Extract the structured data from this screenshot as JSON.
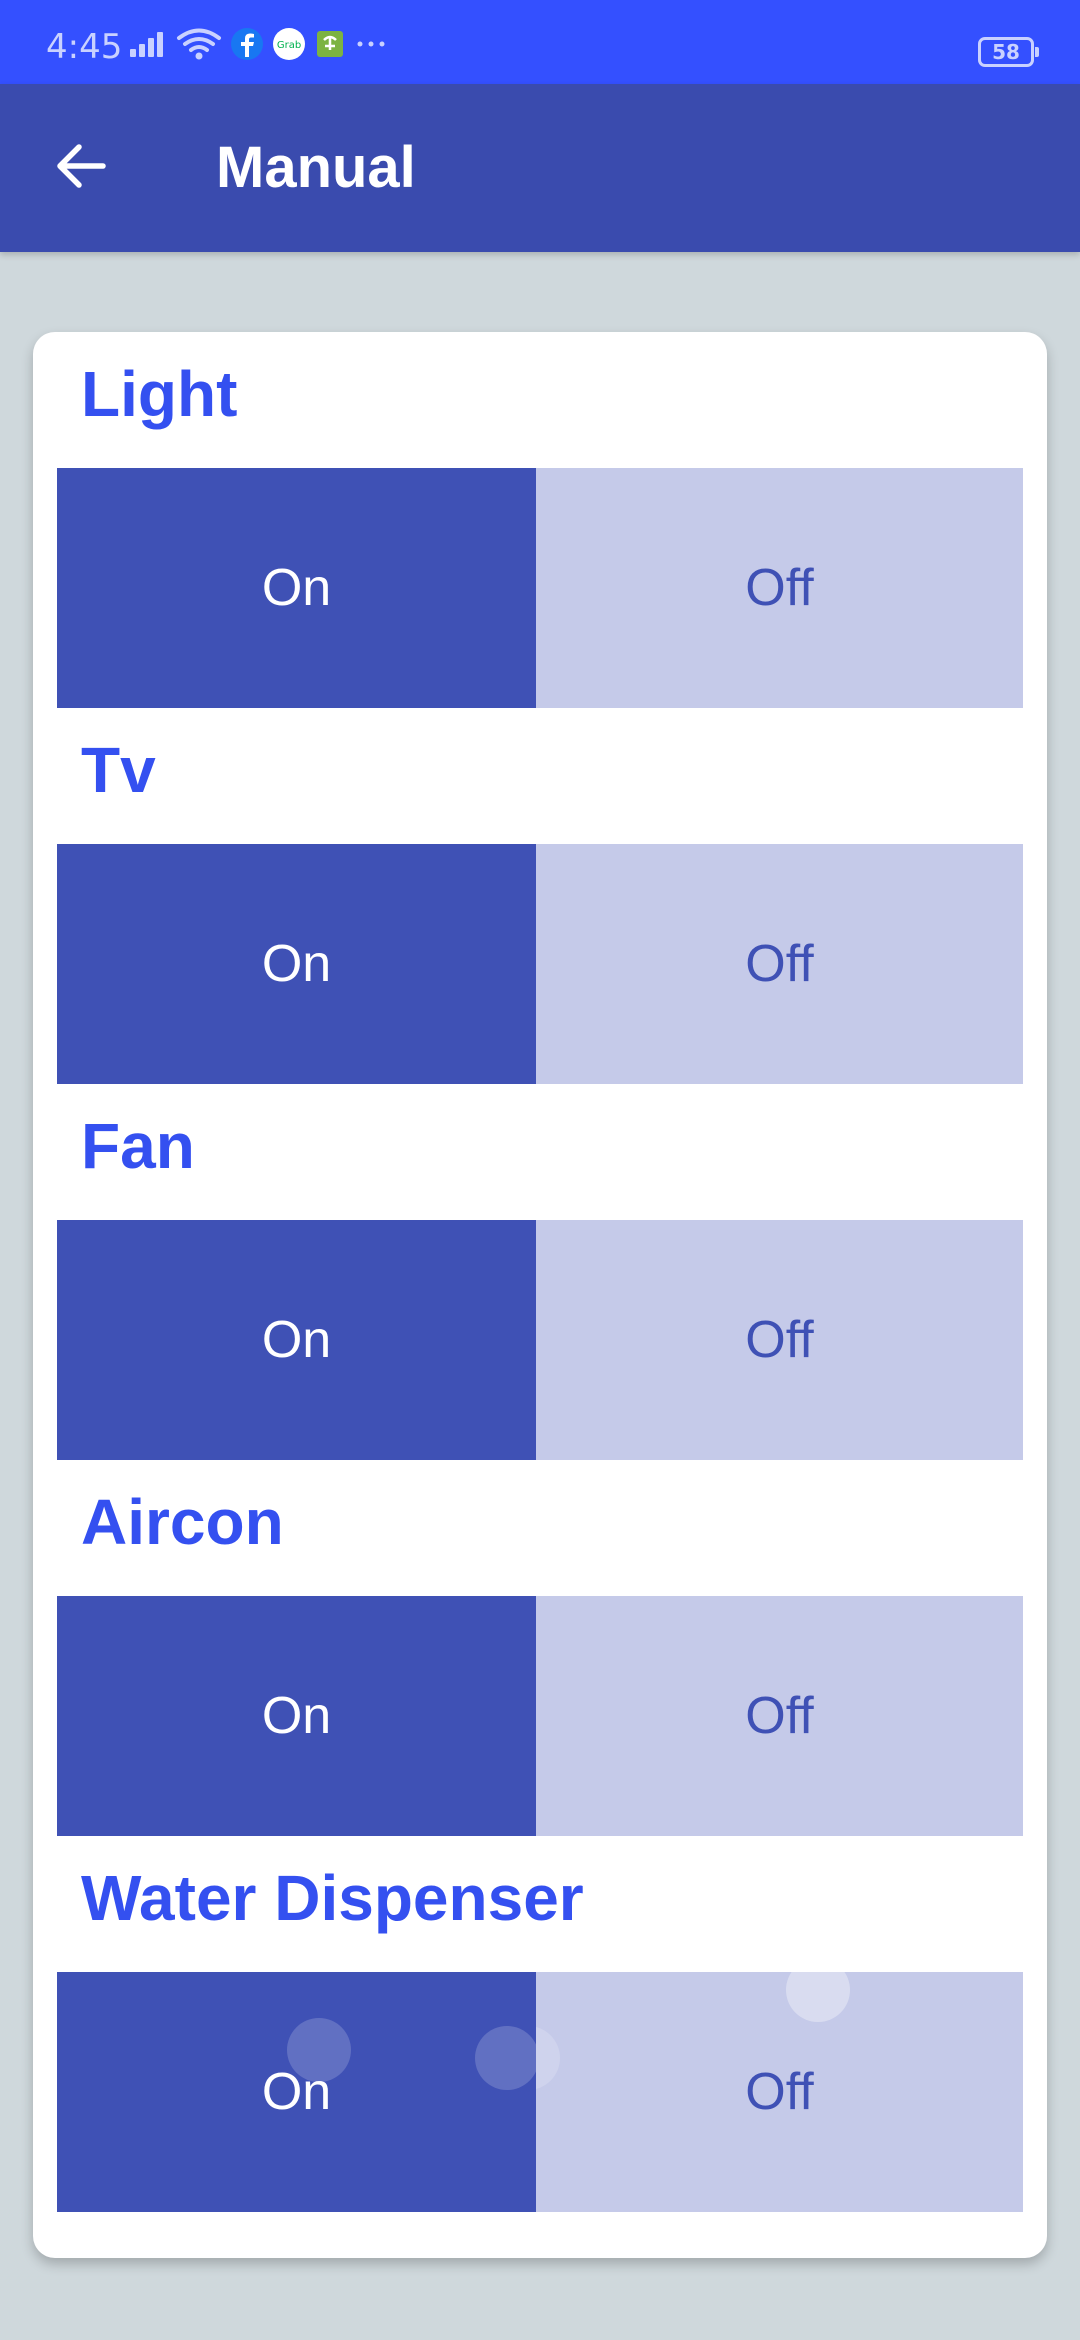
{
  "status_bar": {
    "time": "4:45",
    "battery": "58",
    "icons": [
      "signal-icon",
      "wifi-icon",
      "facebook-icon",
      "grab-icon",
      "app-notification-icon",
      "more-dots-icon"
    ]
  },
  "app_bar": {
    "title": "Manual",
    "back_icon": "arrow-back-icon"
  },
  "colors": {
    "status_bar": "#3450FF",
    "app_bar": "#3A4BAE",
    "background": "#CFD8DC",
    "title_text": "#3450F0",
    "on_button": "#3F51B5",
    "off_button": "#C5CAE9"
  },
  "devices": [
    {
      "name": "Light",
      "on_label": "On",
      "off_label": "Off"
    },
    {
      "name": "Tv",
      "on_label": "On",
      "off_label": "Off"
    },
    {
      "name": "Fan",
      "on_label": "On",
      "off_label": "Off"
    },
    {
      "name": "Aircon",
      "on_label": "On",
      "off_label": "Off"
    },
    {
      "name": "Water Dispenser",
      "on_label": "On",
      "off_label": "Off"
    }
  ]
}
